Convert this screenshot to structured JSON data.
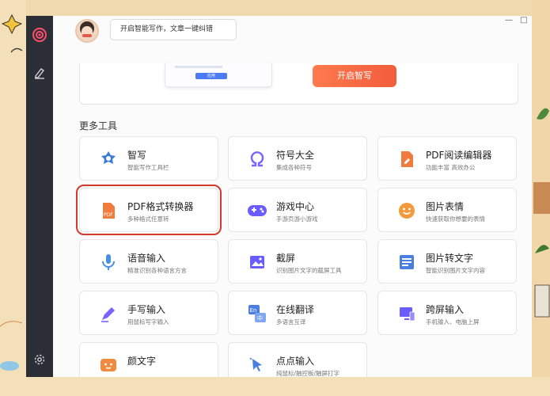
{
  "app": {
    "slogan": "开启智能写作，文章一键纠错",
    "window_controls": [
      "—",
      "□"
    ]
  },
  "promo": {
    "mini_button": "应用",
    "cta_button": "开启智写"
  },
  "tools_section": {
    "title": "更多工具",
    "tools": [
      {
        "name": "智写",
        "desc": "智能写作工具栏",
        "icon": "smart-write-icon",
        "color": "#3a7bd5"
      },
      {
        "name": "符号大全",
        "desc": "集成各种符号",
        "icon": "omega-symbol-icon",
        "color": "#7b61ff"
      },
      {
        "name": "PDF阅读编辑器",
        "desc": "功能丰富 高效办公",
        "icon": "pdf-editor-icon",
        "color": "#f07b3f"
      },
      {
        "name": "PDF格式转换器",
        "desc": "多种格式任意转",
        "icon": "pdf-converter-icon",
        "color": "#f07b3f"
      },
      {
        "name": "游戏中心",
        "desc": "手游页游小游戏",
        "icon": "gamepad-icon",
        "color": "#6a5cff"
      },
      {
        "name": "图片表情",
        "desc": "快速获取你想要的表情",
        "icon": "emoji-icon",
        "color": "#f39a3d"
      },
      {
        "name": "语音输入",
        "desc": "精准识别各种语言方言",
        "icon": "microphone-icon",
        "color": "#4a90e2"
      },
      {
        "name": "截屏",
        "desc": "识别图片文字的截屏工具",
        "icon": "screenshot-icon",
        "color": "#6b5cff"
      },
      {
        "name": "图片转文字",
        "desc": "智能识别图片文字内容",
        "icon": "image-to-text-icon",
        "color": "#4a7ee0"
      },
      {
        "name": "手写输入",
        "desc": "用鼠标写字输入",
        "icon": "pen-icon",
        "color": "#7b61ff"
      },
      {
        "name": "在线翻译",
        "desc": "多语言互译",
        "icon": "translate-icon",
        "color": "#4a7ee0"
      },
      {
        "name": "跨屏输入",
        "desc": "手机输入、电脑上屏",
        "icon": "cross-screen-icon",
        "color": "#6b5cff"
      },
      {
        "name": "颜文字",
        "desc": "",
        "icon": "kaomoji-icon",
        "color": "#f08a3f"
      },
      {
        "name": "点点输入",
        "desc": "纯鼠标/触控板/触屏打字",
        "icon": "cursor-click-icon",
        "color": "#4a7ee0"
      }
    ]
  }
}
